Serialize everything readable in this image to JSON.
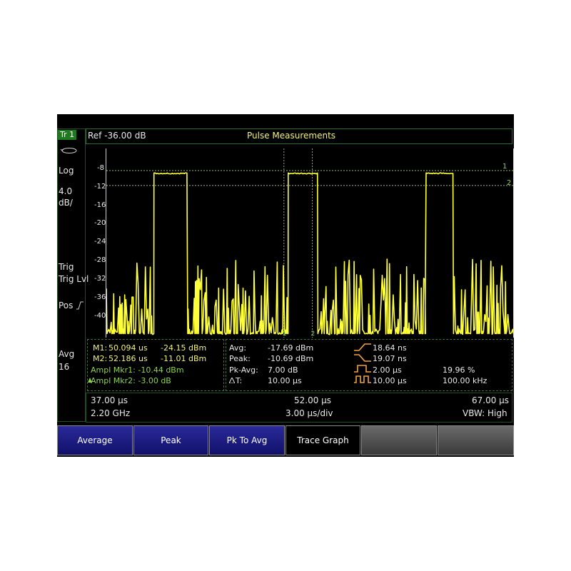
{
  "left_panel": {
    "trace_badge": "Tr 1",
    "scale_mode": "Log",
    "scale_value": "4.0",
    "scale_unit": "dB/",
    "trig": "Trig",
    "trig_level": "Trig Lvl",
    "pos": "Pos",
    "avg_label": "Avg",
    "avg_count": "16"
  },
  "header": {
    "ref_level": "Ref -36.00 dB",
    "title": "Pulse Measurements"
  },
  "y_ticks": [
    "-8",
    "-12",
    "-16",
    "-20",
    "-24",
    "-28",
    "-32",
    "-36",
    "-40"
  ],
  "marker_labels": {
    "m1": "1",
    "m2": "2",
    "m1_bottom": "1",
    "m2_bottom": "2"
  },
  "marker_table": {
    "m1_label": "M1:",
    "m1_time": "50.094 us",
    "m1_value": "-24.15 dBm",
    "m2_label": "M2:",
    "m2_time": "52.186 us",
    "m2_value": "-11.01 dBm",
    "ampl_mkr1": "Ampl Mkr1: -10.44  dBm",
    "ampl_mkr2": "Ampl Mkr2: -3.00 dB"
  },
  "measurements": {
    "avg_label": "Avg:",
    "avg_value": "-17.69  dBm",
    "peak_label": "Peak:",
    "peak_value": "-10.69  dBm",
    "pkavg_label": "Pk-Avg:",
    "pkavg_value": "7.00  dB",
    "dt_label": "T:",
    "dt_value": "10.00 µs",
    "rise_time": "18.64 ns",
    "fall_time": "19.07 ns",
    "pulse_width": "2.00 µs",
    "duty_cycle": "19.96  %",
    "period": "10.00 µs",
    "prf": "100.00 kHz"
  },
  "footer": {
    "start_time": "37.00 µs",
    "center_time": "52.00 µs",
    "stop_time": "67.00 µs",
    "freq": "2.20 GHz",
    "time_div": "3.00 µs/div",
    "vbw": "VBW: High"
  },
  "softkeys": [
    "Average",
    "Peak",
    "Pk To Avg",
    "Trace Graph",
    "",
    ""
  ],
  "colors": {
    "trace": "#ffff3a",
    "accent_green": "#8fd14f",
    "softkey_blue": "#1a1a80",
    "icon_orange": "#f0a040"
  },
  "chart_data": {
    "type": "line",
    "x_range": [
      37.0,
      67.0
    ],
    "ylim": [
      -44,
      -6
    ],
    "y_ticks": [
      -8,
      -12,
      -16,
      -20,
      -24,
      -28,
      -32,
      -36,
      -40
    ],
    "pulses": [
      {
        "start": 40.5,
        "end": 43.0,
        "level": -11.0
      },
      {
        "start": 50.4,
        "end": 52.6,
        "level": -11.0
      },
      {
        "start": 60.5,
        "end": 62.6,
        "level": -11.0
      }
    ],
    "reference_lines": [
      -10.44,
      -13.44
    ],
    "marker_x": [
      50.094,
      52.186
    ],
    "grid": false
  }
}
